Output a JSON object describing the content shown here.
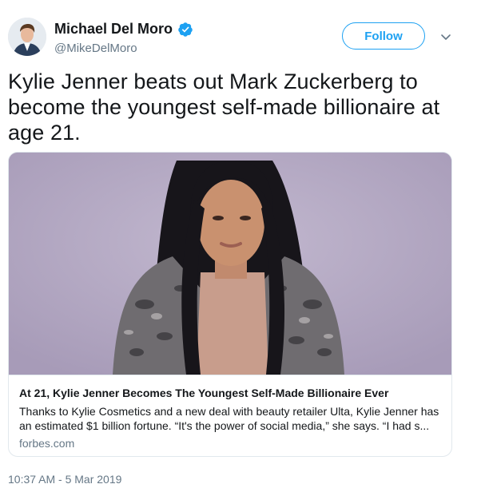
{
  "author": {
    "name": "Michael Del Moro",
    "handle": "@MikeDelMoro",
    "verified": true
  },
  "follow_label": "Follow",
  "tweet_text": "Kylie Jenner beats out Mark Zuckerberg to become the youngest self-made billionaire at age 21.",
  "card": {
    "title": "At 21, Kylie Jenner Becomes The Youngest Self-Made Billionaire Ever",
    "description": "Thanks to Kylie Cosmetics and a new deal with beauty retailer Ulta, Kylie Jenner has an estimated $1 billion fortune. “It's the power of social media,” she says. “I had s...",
    "domain": "forbes.com"
  },
  "timestamp": "10:37 AM - 5 Mar 2019",
  "colors": {
    "accent": "#1da1f2",
    "secondary_text": "#657786",
    "border": "#e1e8ed"
  },
  "icons": {
    "verified": "verified-badge-icon",
    "more": "chevron-down-icon"
  }
}
